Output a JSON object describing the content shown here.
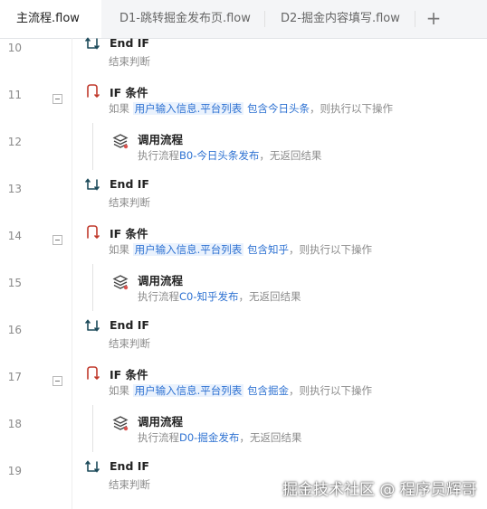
{
  "tabs": [
    {
      "label": "主流程.flow",
      "active": true
    },
    {
      "label": "D1-跳转掘金发布页.flow",
      "active": false
    },
    {
      "label": "D2-掘金内容填写.flow",
      "active": false
    }
  ],
  "add_tab_label": "+",
  "rows": [
    {
      "line": "10",
      "title": "End IF",
      "desc": "结束判断"
    },
    {
      "line": "11",
      "title": "IF 条件",
      "desc_prefix": "如果",
      "var": "用户输入信息.平台列表",
      "cond": "包含今日头条",
      "desc_suffix": "，则执行以下操作"
    },
    {
      "line": "12",
      "title": "调用流程",
      "desc_prefix": "执行流程",
      "flow": "B0-今日头条发布",
      "desc_suffix": "，无返回结果"
    },
    {
      "line": "13",
      "title": "End IF",
      "desc": "结束判断"
    },
    {
      "line": "14",
      "title": "IF 条件",
      "desc_prefix": "如果",
      "var": "用户输入信息.平台列表",
      "cond": "包含知乎",
      "desc_suffix": "，则执行以下操作"
    },
    {
      "line": "15",
      "title": "调用流程",
      "desc_prefix": "执行流程",
      "flow": "C0-知乎发布",
      "desc_suffix": "，无返回结果"
    },
    {
      "line": "16",
      "title": "End IF",
      "desc": "结束判断"
    },
    {
      "line": "17",
      "title": "IF 条件",
      "desc_prefix": "如果",
      "var": "用户输入信息.平台列表",
      "cond": "包含掘金",
      "desc_suffix": "，则执行以下操作"
    },
    {
      "line": "18",
      "title": "调用流程",
      "desc_prefix": "执行流程",
      "flow": "D0-掘金发布",
      "desc_suffix": "，无返回结果"
    },
    {
      "line": "19",
      "title": "End IF",
      "desc": "结束判断"
    }
  ],
  "watermark": "掘金技术社区 @ 程序员辉哥",
  "icons": {
    "end_if": "end-if-icon",
    "if": "if-condition-icon",
    "call": "call-flow-icon",
    "fold": "collapse-icon"
  },
  "colors": {
    "accent": "#2e72d2",
    "highlight_bg": "#eaf2fd",
    "end_if_icon": "#1c4a5a",
    "if_icon": "#c0392b"
  }
}
